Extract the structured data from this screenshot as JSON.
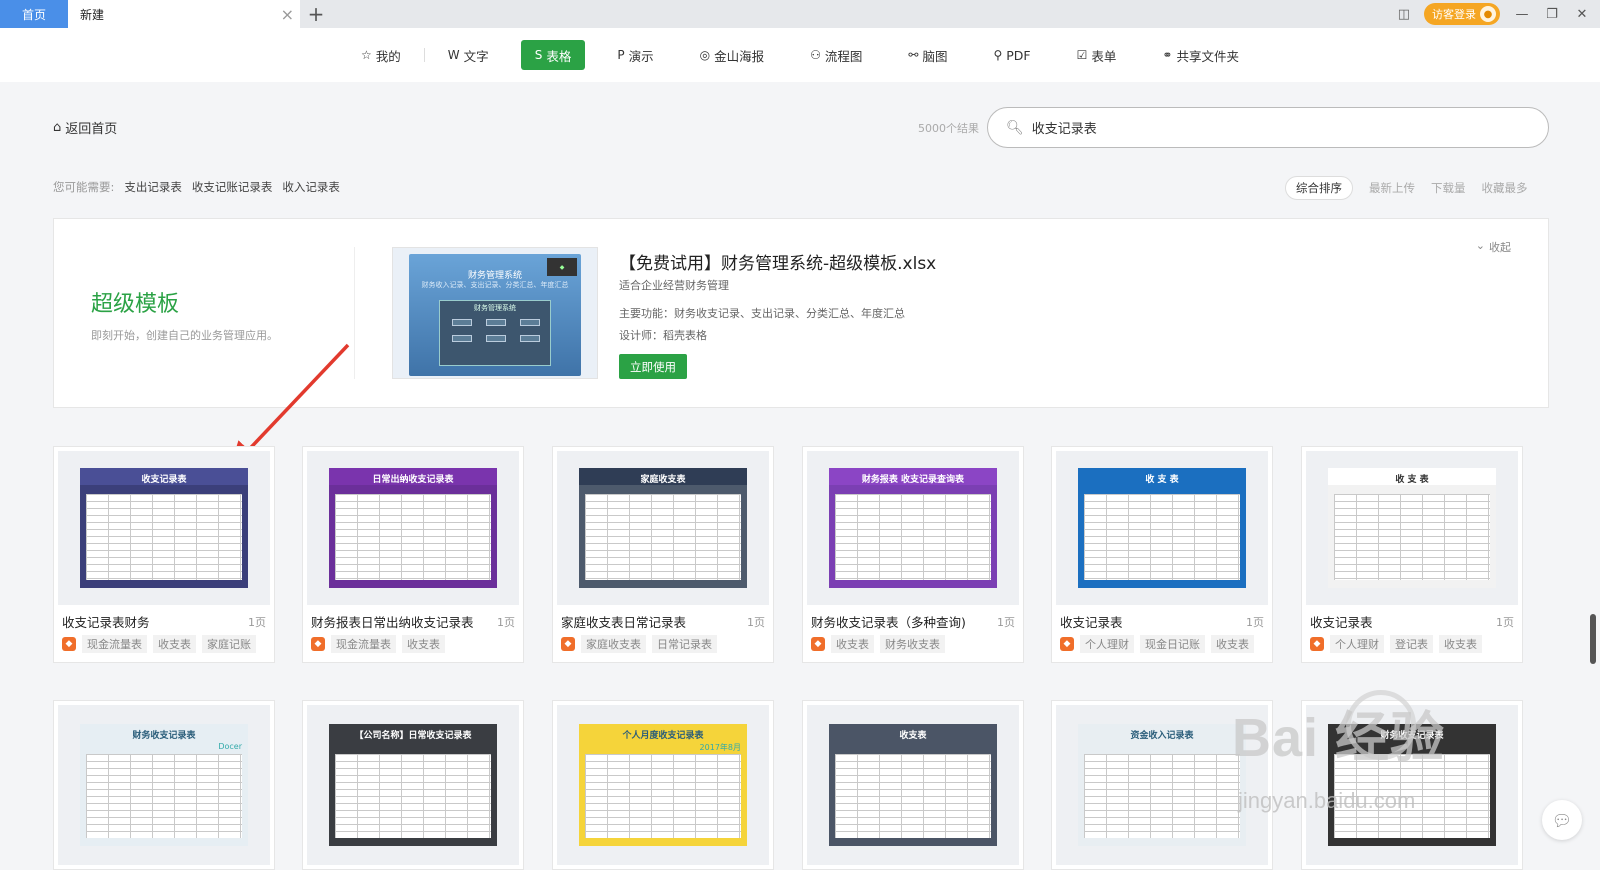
{
  "titlebar": {
    "home_tab": "首页",
    "new_tab": "新建",
    "add_tab": "+",
    "login": "访客登录"
  },
  "nav": [
    {
      "icon": "☆",
      "label": "我的",
      "icon_name": "star-icon"
    },
    {
      "icon": "W",
      "label": "文字",
      "icon_name": "writer-icon"
    },
    {
      "icon": "S",
      "label": "表格",
      "icon_name": "sheet-icon",
      "active": true
    },
    {
      "icon": "P",
      "label": "演示",
      "icon_name": "presentation-icon"
    },
    {
      "icon": "◎",
      "label": "金山海报",
      "icon_name": "poster-icon"
    },
    {
      "icon": "⚇",
      "label": "流程图",
      "icon_name": "flowchart-icon"
    },
    {
      "icon": "⚯",
      "label": "脑图",
      "icon_name": "mindmap-icon"
    },
    {
      "icon": "⚲",
      "label": "PDF",
      "icon_name": "pdf-icon"
    },
    {
      "icon": "☑",
      "label": "表单",
      "icon_name": "form-icon"
    },
    {
      "icon": "⚭",
      "label": "共享文件夹",
      "icon_name": "shared-folder-icon"
    }
  ],
  "back_label": "返回首页",
  "search": {
    "result_count": "5000个结果",
    "value": "收支记录表"
  },
  "suggest": {
    "label": "您可能需要:",
    "items": [
      "支出记录表",
      "收支记账记录表",
      "收入记录表"
    ]
  },
  "sort": {
    "options": [
      "综合排序",
      "最新上传",
      "下载量",
      "收藏最多"
    ],
    "active": "综合排序"
  },
  "banner": {
    "heading": "超级模板",
    "subheading": "即刻开始，创建自己的业务管理应用。",
    "thumb_title": "财务管理系统",
    "thumb_sub": "财务收入记录、支出记录、分类汇总、年度汇总",
    "thumb_panel": "财务管理系统",
    "title": "【免费试用】财务管理系统-超级模板.xlsx",
    "desc": "适合企业经营财务管理",
    "features": "主要功能：财务收支记录、支出记录、分类汇总、年度汇总",
    "designer": "设计师：稻壳表格",
    "use_button": "立即使用",
    "collapse": "收起"
  },
  "cards": [
    {
      "name": "收支记录表财务",
      "pages": "1页",
      "tags": [
        "现金流量表",
        "收支表",
        "家庭记账"
      ],
      "thumb_title": "收支记录表",
      "thumb_bg": "#3b3f7a",
      "thumb_hdr": "#4a4f96"
    },
    {
      "name": "财务报表日常出纳收支记录表",
      "pages": "1页",
      "tags": [
        "现金流量表",
        "收支表"
      ],
      "thumb_title": "日常出纳收支记录表",
      "thumb_bg": "#6b2f9a",
      "thumb_hdr": "#7a34ad"
    },
    {
      "name": "家庭收支表日常记录表",
      "pages": "1页",
      "tags": [
        "家庭收支表",
        "日常记录表"
      ],
      "thumb_title": "家庭收支表",
      "thumb_bg": "#4d5a6c",
      "thumb_hdr": "#2f3d55"
    },
    {
      "name": "财务收支记录表（多种查询)",
      "pages": "1页",
      "tags": [
        "收支表",
        "财务收支表"
      ],
      "thumb_title": "财务报表 收支记录查询表",
      "thumb_bg": "#7b3fb3",
      "thumb_hdr": "#8b45c5"
    },
    {
      "name": "收支记录表",
      "pages": "1页",
      "tags": [
        "个人理财",
        "现金日记账",
        "收支表"
      ],
      "thumb_title": "收 支 表",
      "thumb_bg": "#1b6fc0",
      "thumb_hdr": "#1b6fc0"
    },
    {
      "name": "收支记录表",
      "pages": "1页",
      "tags": [
        "个人理财",
        "登记表",
        "收支表"
      ],
      "thumb_title": "收 支 表",
      "thumb_bg": "#f2f2f2",
      "thumb_hdr": "#ffffff"
    }
  ],
  "cards_row2": [
    {
      "thumb_title": "财务收支记录表",
      "thumb_extra": "Docer",
      "thumb_bg": "#e6eef3"
    },
    {
      "thumb_title": "【公司名称】日常收支记录表",
      "thumb_bg": "#3a3d42"
    },
    {
      "thumb_title": "个人月度收支记录表",
      "thumb_extra": "2017年8月",
      "thumb_bg": "#f5d43a"
    },
    {
      "thumb_title": "收支表",
      "thumb_bg": "#4b5566"
    },
    {
      "thumb_title": "资金收入记录表",
      "thumb_bg": "#e8eef2"
    },
    {
      "thumb_title": "财务收支记录表",
      "thumb_bg": "#333333"
    }
  ],
  "watermark": {
    "main": "Bai 经验",
    "sub": "jingyan.baidu.com"
  }
}
